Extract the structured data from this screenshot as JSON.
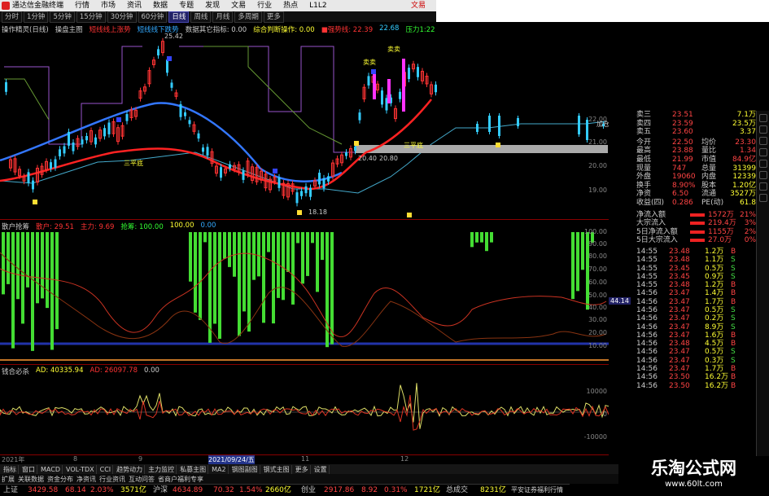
{
  "window": {
    "app_title": "通达信金融终端",
    "menu": [
      "行情",
      "市场",
      "资讯",
      "数据",
      "专题",
      "发现",
      "文易",
      "行业",
      "热点",
      "L1L2"
    ],
    "exchange_tab": "文易"
  },
  "periods": [
    {
      "label": "分时",
      "active": false
    },
    {
      "label": "1分钟",
      "active": false
    },
    {
      "label": "5分钟",
      "active": false
    },
    {
      "label": "15分钟",
      "active": false
    },
    {
      "label": "30分钟",
      "active": false
    },
    {
      "label": "60分钟",
      "active": false
    },
    {
      "label": "日线",
      "active": true
    },
    {
      "label": "周线",
      "active": false
    },
    {
      "label": "月线",
      "active": false
    },
    {
      "label": "多周期",
      "active": false
    },
    {
      "label": "更多",
      "active": false
    }
  ],
  "main_panel": {
    "legend": [
      {
        "text": "操作精灵(日线)",
        "color": "#cccccc"
      },
      {
        "text": "操盘主图",
        "color": "#cccccc"
      },
      {
        "text": "短线线上涨势",
        "color": "#ff3333"
      },
      {
        "text": "短线线下跌势",
        "color": "#33aaff"
      },
      {
        "text": "数据其它指标: 0.00",
        "color": "#cccccc"
      },
      {
        "text": "综合判断操作: 0.00",
        "color": "#ffff33"
      },
      {
        "text": "■强势线: 22.39",
        "color": "#ff3333"
      },
      {
        "text": "22.68",
        "color": "#33ccff"
      },
      {
        "text": "压力1:22",
        "color": "#33ff33"
      }
    ],
    "annotations": {
      "high_label": "25.42",
      "low_label": "18.18",
      "mid_left": "20.40",
      "mid_right": "20.80",
      "sanping1": "三平底",
      "sanping2": "三平底",
      "sell1": "卖卖",
      "sell2": "卖卖",
      "jiacang": "加仓"
    },
    "y_ticks": [
      "22.00",
      "21.00",
      "20.00",
      "19.00"
    ]
  },
  "mid_panel": {
    "legend": [
      {
        "text": "散户抢筹",
        "color": "#cccccc"
      },
      {
        "text": "散户: 29.51",
        "color": "#ff3333"
      },
      {
        "text": "主力: 9.69",
        "color": "#ff3333"
      },
      {
        "text": "抢筹: 100.00",
        "color": "#33ff33"
      },
      {
        "text": "100.00",
        "color": "#ffff33"
      },
      {
        "text": "0.00",
        "color": "#33aaff"
      }
    ],
    "y_ticks": [
      "100.00",
      "90.00",
      "80.00",
      "70.00",
      "60.00",
      "50.00",
      "40.00",
      "30.00",
      "20.00",
      "10.00"
    ],
    "cursor_value": "44.14"
  },
  "low_panel": {
    "legend": [
      {
        "text": "钱合必杀",
        "color": "#cccccc"
      },
      {
        "text": "AD: 40335.94",
        "color": "#ffff33"
      },
      {
        "text": "AD: 26097.78",
        "color": "#ff3333"
      },
      {
        "text": "0.00",
        "color": "#cccccc"
      }
    ],
    "y_ticks": [
      "10000",
      "0",
      "-10000"
    ]
  },
  "x_axis": {
    "labels": [
      "2021年",
      "8",
      "9",
      "2021/09/24/五",
      "11",
      "12"
    ],
    "selected_date": "2021/09/24/五"
  },
  "bottom_tabs": [
    "指标",
    "窗口",
    "MACD",
    "VOL-TDX",
    "CCI",
    "趋势动力",
    "主力监控",
    "私募主图",
    "MA2",
    "钢图副图",
    "钢式主图",
    "更多",
    "设置"
  ],
  "bottom_tabs_right": [
    "扩展",
    "关联数据",
    "资金分布",
    "净资讯",
    "行业资讯",
    "互动问答",
    "省商户福利专享"
  ],
  "quote": {
    "order_book": [
      {
        "label": "卖三",
        "price": "23.51",
        "vol": "7.1万"
      },
      {
        "label": "卖四",
        "price": "23.59",
        "vol": "23.5万"
      },
      {
        "label": "卖五",
        "price": "23.60",
        "vol": "3.37"
      }
    ],
    "stats": [
      {
        "a": "今开",
        "b": "22.50",
        "c": "均价",
        "d": "23.30"
      },
      {
        "a": "最高",
        "b": "23.88",
        "c": "量比",
        "d": "1.34"
      },
      {
        "a": "最低",
        "b": "21.99",
        "c": "市值",
        "d": "84.9亿"
      },
      {
        "a": "现量",
        "b": "747",
        "c": "总量",
        "d": "31399"
      },
      {
        "a": "外盘",
        "b": "19060",
        "c": "内盘",
        "d": "12339"
      },
      {
        "a": "换手",
        "b": "8.90%",
        "c": "股本",
        "d": "1.20亿"
      },
      {
        "a": "净资",
        "b": "6.50",
        "c": "流通",
        "d": "3527万"
      },
      {
        "a": "收益(四)",
        "b": "0.286",
        "c": "PE(动)",
        "d": "61.8"
      }
    ],
    "flows": [
      {
        "label": "净流入额",
        "value": "1572万",
        "pct": "21%"
      },
      {
        "label": "大宗流入",
        "value": "219.4万",
        "pct": "3%"
      },
      {
        "label": "5日净流入额",
        "value": "1155万",
        "pct": "2%"
      },
      {
        "label": "5日大宗流入",
        "value": "27.0万",
        "pct": "0%"
      }
    ],
    "ticks": [
      {
        "time": "14:55",
        "price": "23.48",
        "vol": "1.2万",
        "side": "B"
      },
      {
        "time": "14:55",
        "price": "23.48",
        "vol": "1.1万",
        "side": "S"
      },
      {
        "time": "14:55",
        "price": "23.45",
        "vol": "0.5万",
        "side": "S"
      },
      {
        "time": "14:55",
        "price": "23.45",
        "vol": "0.9万",
        "side": "S"
      },
      {
        "time": "14:55",
        "price": "23.48",
        "vol": "1.2万",
        "side": "B"
      },
      {
        "time": "14:56",
        "price": "23.47",
        "vol": "1.4万",
        "side": "B"
      },
      {
        "time": "14:56",
        "price": "23.47",
        "vol": "1.7万",
        "side": "B"
      },
      {
        "time": "14:56",
        "price": "23.47",
        "vol": "0.5万",
        "side": "S"
      },
      {
        "time": "14:56",
        "price": "23.47",
        "vol": "0.2万",
        "side": "S"
      },
      {
        "time": "14:56",
        "price": "23.47",
        "vol": "8.9万",
        "side": "S"
      },
      {
        "time": "14:56",
        "price": "23.47",
        "vol": "1.6万",
        "side": "B"
      },
      {
        "time": "14:56",
        "price": "23.48",
        "vol": "4.5万",
        "side": "B"
      },
      {
        "time": "14:56",
        "price": "23.47",
        "vol": "0.5万",
        "side": "S"
      },
      {
        "time": "14:56",
        "price": "23.47",
        "vol": "0.3万",
        "side": "S"
      },
      {
        "time": "14:56",
        "price": "23.47",
        "vol": "1.7万",
        "side": "B"
      },
      {
        "time": "14:56",
        "price": "23.50",
        "vol": "16.2万",
        "side": "B"
      },
      {
        "time": "14:56",
        "price": "23.50",
        "vol": "16.2万",
        "side": "B"
      }
    ]
  },
  "status_bar": {
    "items": [
      {
        "text": "上证",
        "color": "#cccccc"
      },
      {
        "text": "3429.58",
        "color": "#ff4444"
      },
      {
        "text": "68.14",
        "color": "#ff4444"
      },
      {
        "text": "2.03%",
        "color": "#ff4444"
      },
      {
        "text": "3571亿",
        "color": "#ffff33"
      },
      {
        "text": "沪深",
        "color": "#cccccc"
      },
      {
        "text": "4634.89",
        "color": "#ff4444"
      },
      {
        "text": "70.32",
        "color": "#ff4444"
      },
      {
        "text": "1.54%",
        "color": "#ff4444"
      },
      {
        "text": "2660亿",
        "color": "#ffff33"
      },
      {
        "text": "创业",
        "color": "#cccccc"
      },
      {
        "text": "2917.86",
        "color": "#ff4444"
      },
      {
        "text": "8.92",
        "color": "#ff4444"
      },
      {
        "text": "0.31%",
        "color": "#ff4444"
      },
      {
        "text": "1721亿",
        "color": "#ffff33"
      },
      {
        "text": "总成交",
        "color": "#cccccc"
      },
      {
        "text": "8231亿",
        "color": "#ffff33"
      },
      {
        "text": "平安证券福利行情",
        "color": "#cccccc"
      }
    ]
  },
  "brand": {
    "title": "乐淘公式网",
    "url": "www.60lt.com"
  },
  "colors": {
    "up": "#ff3333",
    "down": "#33ccff",
    "ma_red": "#ff2222",
    "ma_blue": "#3377ff",
    "green_bar": "#44dd33"
  }
}
